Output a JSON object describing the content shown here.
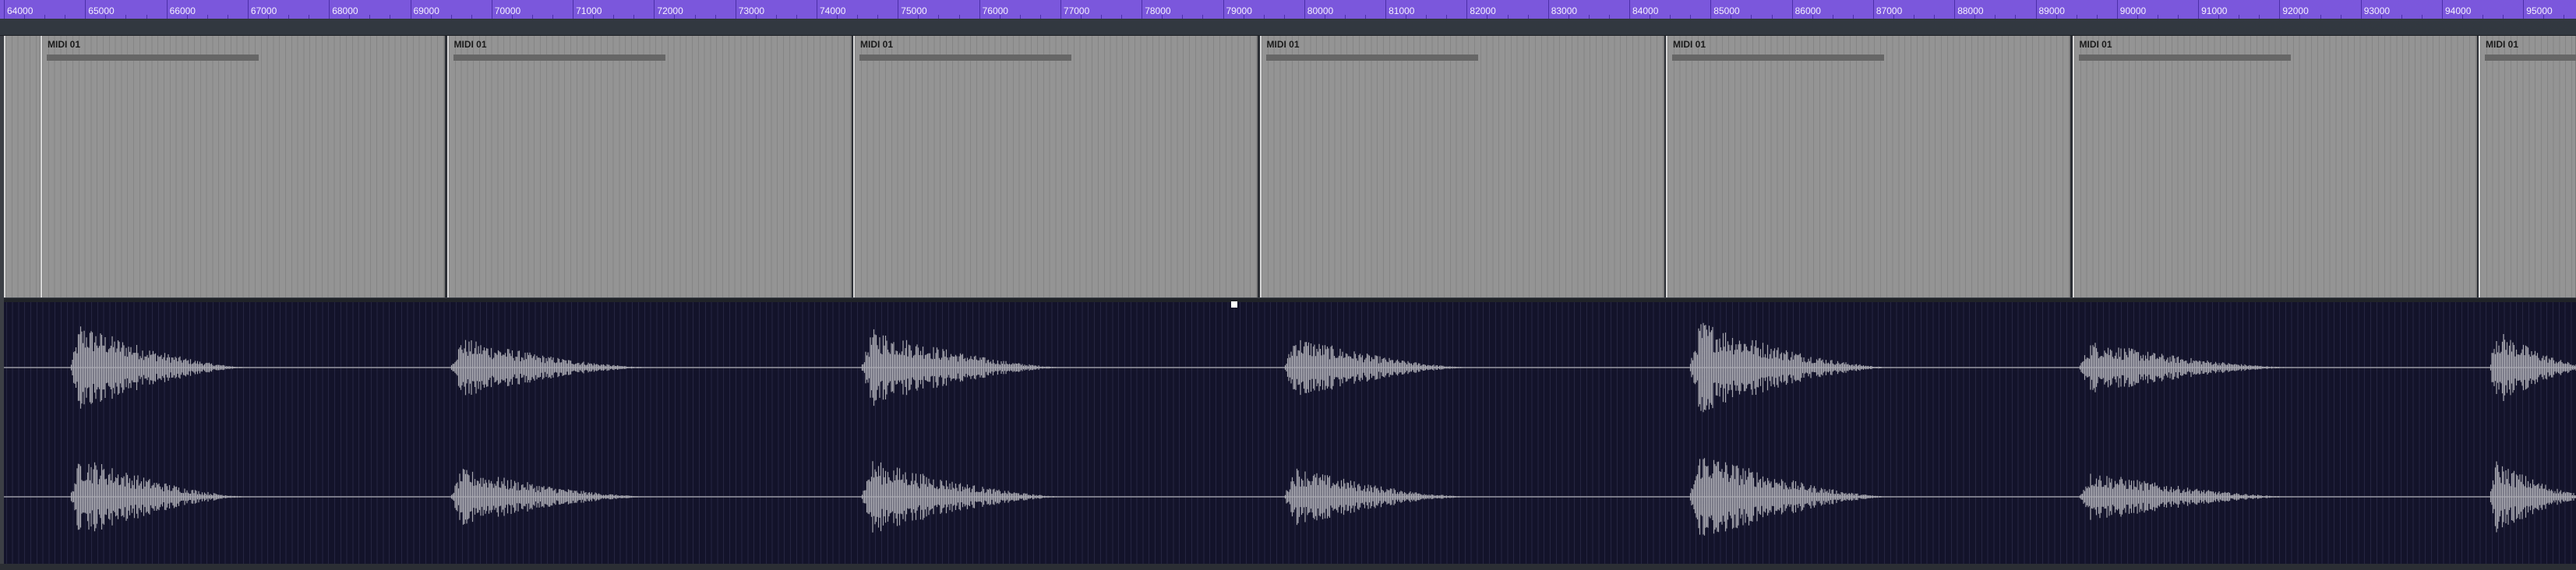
{
  "ruler": {
    "labels": [
      "64000",
      "65000",
      "66000",
      "67000",
      "68000",
      "69000",
      "70000",
      "71000",
      "72000",
      "73000",
      "74000",
      "75000",
      "76000",
      "77000",
      "78000",
      "79000",
      "80000",
      "81000",
      "82000",
      "83000",
      "84000",
      "85000",
      "86000",
      "87000",
      "88000",
      "89000",
      "90000",
      "91000",
      "92000",
      "93000",
      "94000",
      "95000"
    ]
  },
  "midi_track": {
    "clips": [
      {
        "name": "MIDI 01"
      },
      {
        "name": "MIDI 01"
      },
      {
        "name": "MIDI 01"
      },
      {
        "name": "MIDI 01"
      },
      {
        "name": "MIDI 01"
      },
      {
        "name": "MIDI 01"
      },
      {
        "name": "MIDI 01"
      }
    ]
  },
  "colors": {
    "ruler": "#7b57dc",
    "midi_clip": "#949494",
    "audio_background": "#13132a",
    "waveform": "#a8a8b0"
  }
}
